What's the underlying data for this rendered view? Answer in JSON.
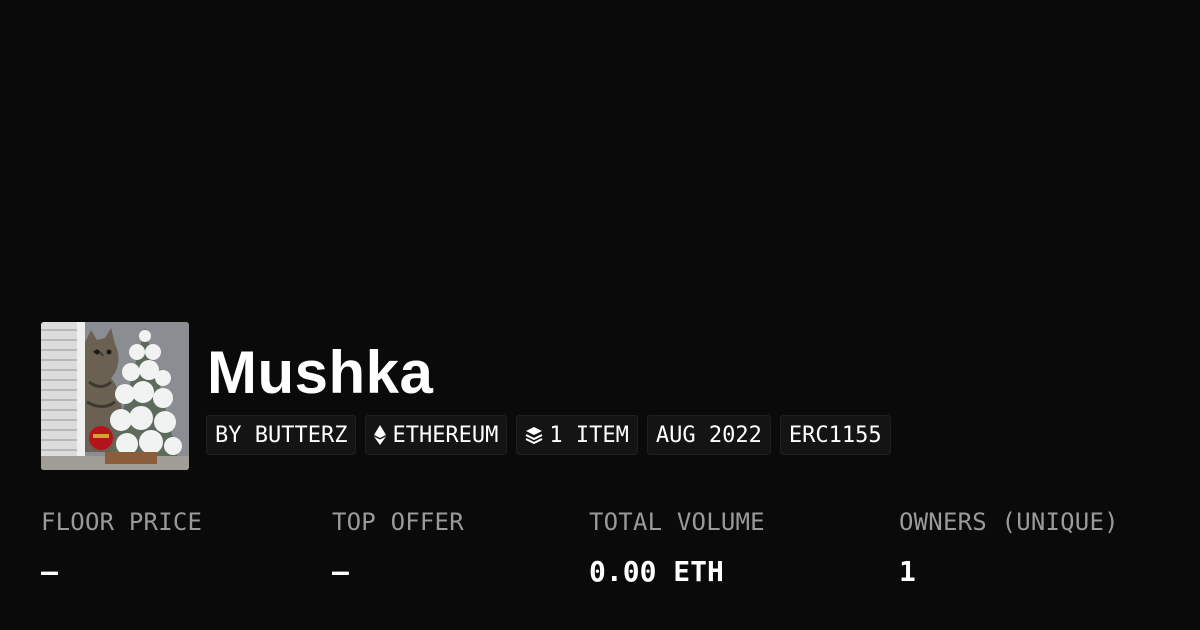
{
  "collection": {
    "name": "Mushka",
    "avatar_icon": "cat-christmas-tree-photo"
  },
  "badges": {
    "creator": "BY BUTTERZ",
    "chain": "ETHEREUM",
    "chain_icon": "ethereum-icon",
    "items": "1 ITEM",
    "items_icon": "layers-icon",
    "date": "AUG 2022",
    "standard": "ERC1155"
  },
  "stats": [
    {
      "label": "FLOOR PRICE",
      "value": "–"
    },
    {
      "label": "TOP OFFER",
      "value": "–"
    },
    {
      "label": "TOTAL VOLUME",
      "value": "0.00 ETH"
    },
    {
      "label": "OWNERS (UNIQUE)",
      "value": "1"
    }
  ],
  "colors": {
    "background": "#0a0a0a",
    "badge_bg": "#141414",
    "label_gray": "#9a9a9a",
    "text": "#ffffff"
  }
}
